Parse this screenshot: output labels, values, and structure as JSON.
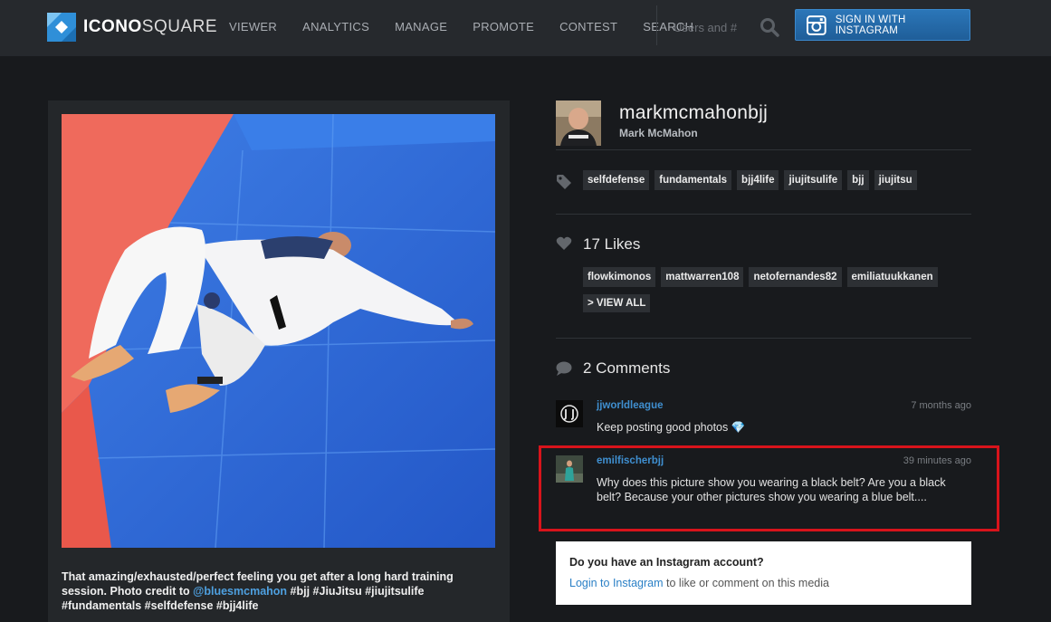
{
  "brand": {
    "name_bold": "ICONO",
    "name_light": "SQUARE"
  },
  "nav": {
    "items": [
      "VIEWER",
      "ANALYTICS",
      "MANAGE",
      "PROMOTE",
      "CONTEST",
      "SEARCH"
    ],
    "search_placeholder": "Users and #",
    "signin_label": "SIGN IN WITH INSTAGRAM"
  },
  "post": {
    "caption_part1": "That amazing/exhausted/perfect feeling you get after a long hard training session. Photo credit to ",
    "caption_mention": "@bluesmcmahon",
    "caption_part2": " #bjj #JiuJitsu #jiujitsulife #fundamentals #selfdefense #bjj4life"
  },
  "profile": {
    "username": "markmcmahonbjj",
    "full_name": "Mark McMahon"
  },
  "tags": [
    "selfdefense",
    "fundamentals",
    "bjj4life",
    "jiujitsulife",
    "bjj",
    "jiujitsu"
  ],
  "likes": {
    "title": "17 Likes",
    "users": [
      "flowkimonos",
      "mattwarren108",
      "netofernandes82",
      "emiliatuukkanen"
    ],
    "view_all": "> VIEW ALL"
  },
  "comments": {
    "title": "2 Comments",
    "items": [
      {
        "user": "jjworldleague",
        "time": "7 months ago",
        "text": "Keep posting good photos 💎"
      },
      {
        "user": "emilfischerbjj",
        "time": "39 minutes ago",
        "text": "Why does this picture show you wearing a black belt? Are you a black belt? Because your other pictures show you wearing a blue belt...."
      }
    ]
  },
  "login_prompt": {
    "title": "Do you have an Instagram account?",
    "link": "Login to Instagram",
    "rest": " to like or comment on this media"
  },
  "colors": {
    "accent": "#3f8fd0",
    "highlight": "#d8131b",
    "topbar": "#26292d",
    "background": "#181a1d"
  }
}
